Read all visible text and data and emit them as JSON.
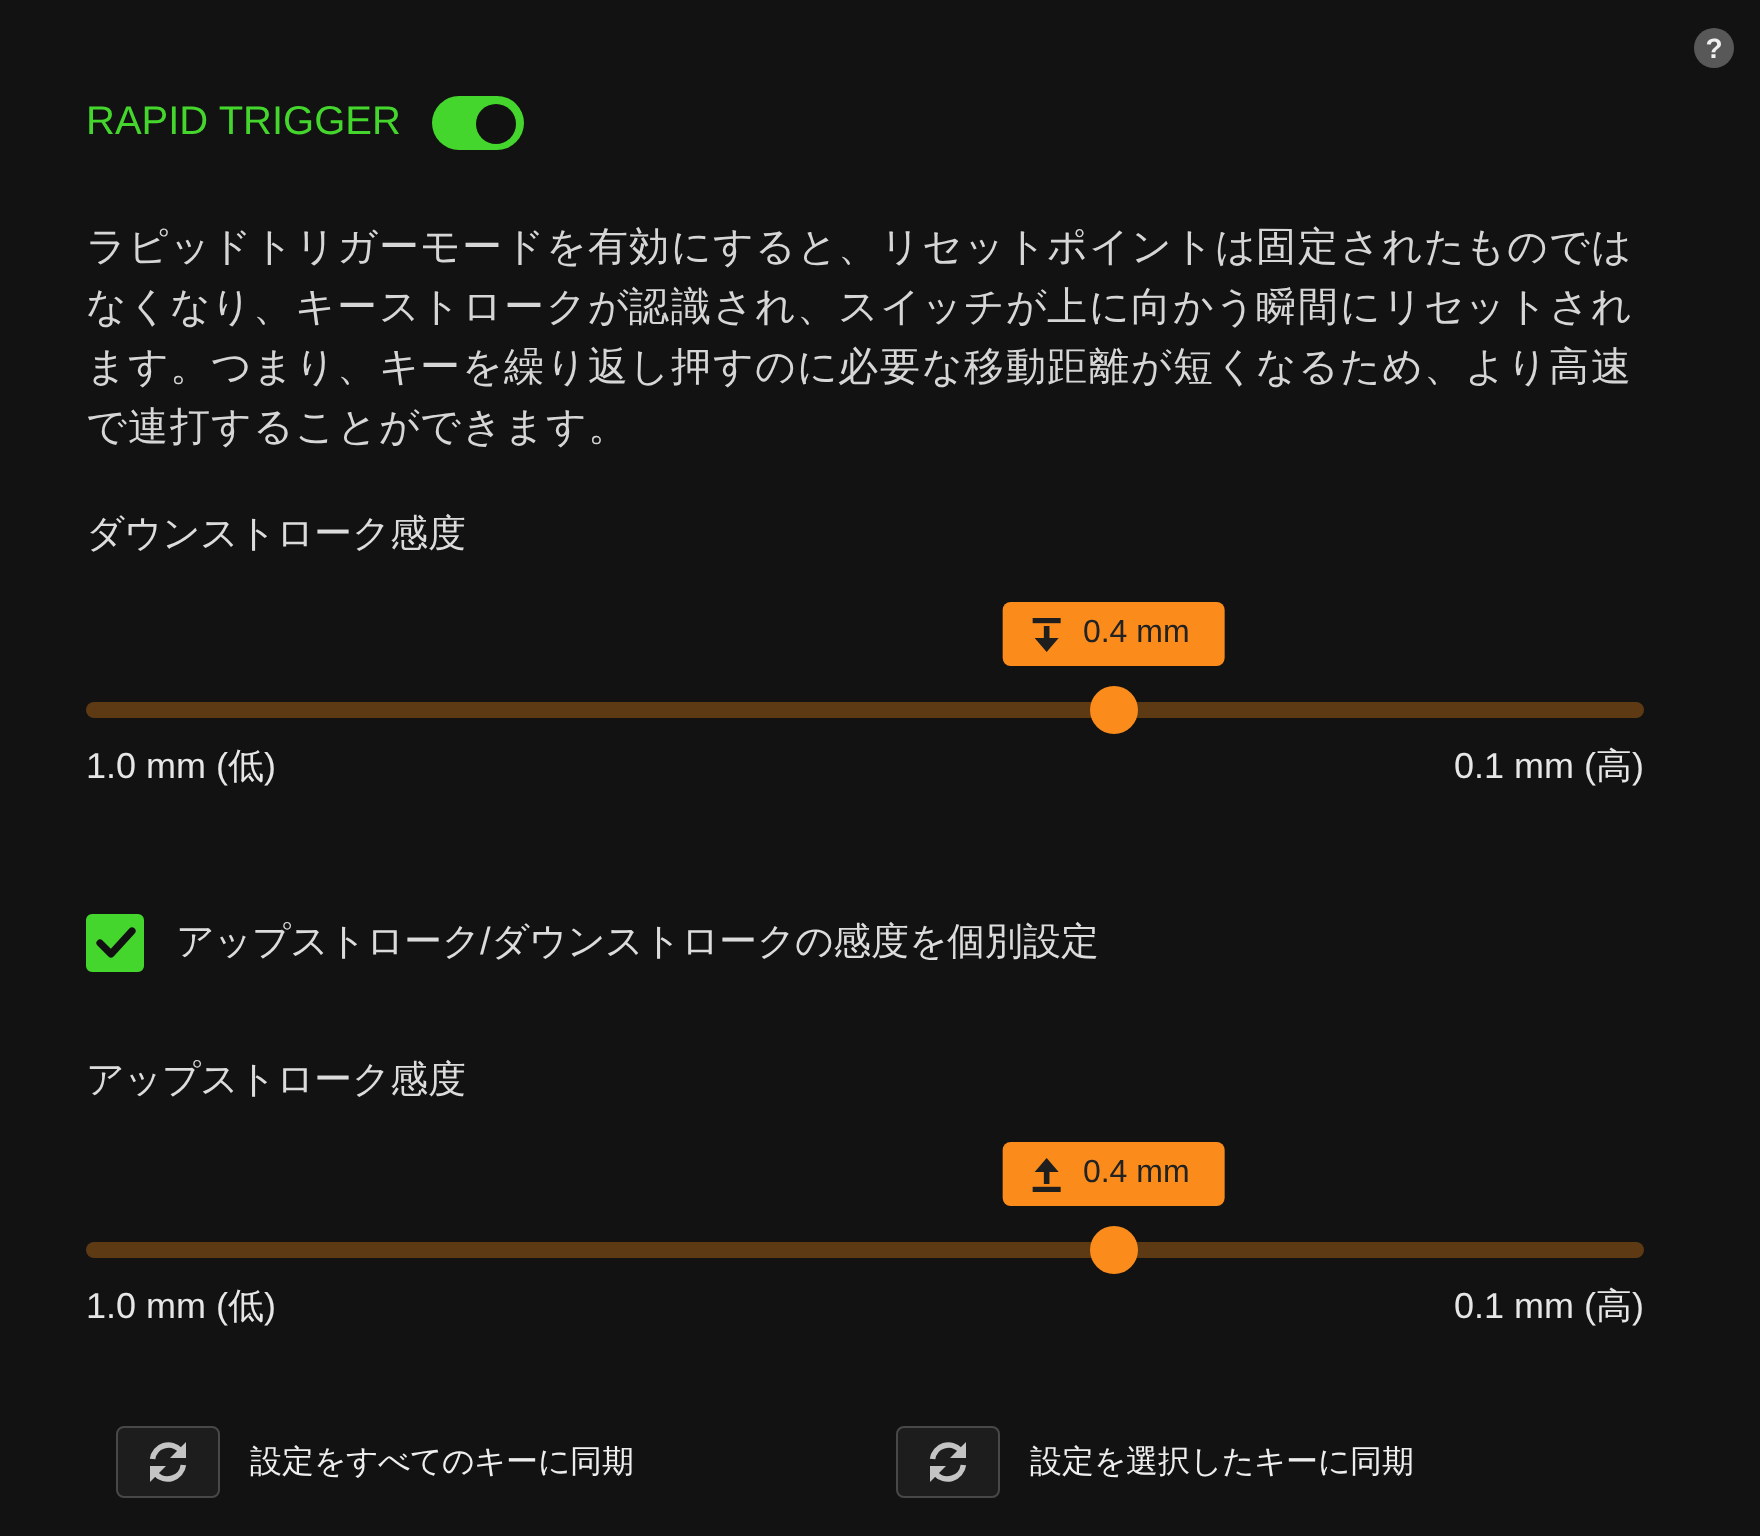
{
  "help_button": {
    "label": "?"
  },
  "rapid_trigger": {
    "title": "RAPID TRIGGER",
    "on": true
  },
  "description": "ラピッドトリガーモードを有効にすると、リセットポイントは固定されたものではなくなり、キーストロークが認識され、スイッチが上に向かう瞬間にリセットされます。つまり、キーを繰り返し押すのに必要な移動距離が短くなるため、より高速で連打することができます。",
  "downstroke_slider": {
    "label": "ダウンストローク感度",
    "value": "0.4 mm",
    "level": 0.66,
    "min_label": "1.0 mm (低)",
    "max_label": "0.1 mm (高)"
  },
  "separate_sensitivity": {
    "label": "アップストローク/ダウンストロークの感度を個別設定",
    "checked": true
  },
  "upstroke_slider": {
    "label": "アップストローク感度",
    "value": "0.4 mm",
    "level": 0.66,
    "min_label": "1.0 mm (低)",
    "max_label": "0.1 mm (高)"
  },
  "sync_buttons": [
    {
      "label": "設定をすべてのキーに同期"
    },
    {
      "label": "設定を選択したキーに同期"
    }
  ]
}
